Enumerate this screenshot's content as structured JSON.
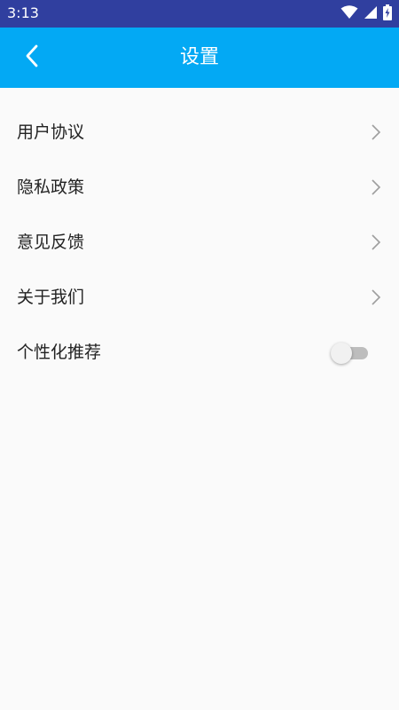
{
  "status_bar": {
    "time": "3:13",
    "icons": [
      "wifi-icon",
      "cellular-signal-icon",
      "battery-charging-icon"
    ]
  },
  "app_bar": {
    "back_icon": "chevron-left-icon",
    "title": "设置",
    "color": "#03a9f4"
  },
  "settings": {
    "items": [
      {
        "label": "用户协议",
        "control": "chevron"
      },
      {
        "label": "隐私政策",
        "control": "chevron"
      },
      {
        "label": "意见反馈",
        "control": "chevron"
      },
      {
        "label": "关于我们",
        "control": "chevron"
      },
      {
        "label": "个性化推荐",
        "control": "toggle",
        "toggle_on": false
      }
    ]
  },
  "colors": {
    "status_bar": "#303f9f",
    "app_bar": "#03a9f4",
    "background": "#fafafa"
  }
}
